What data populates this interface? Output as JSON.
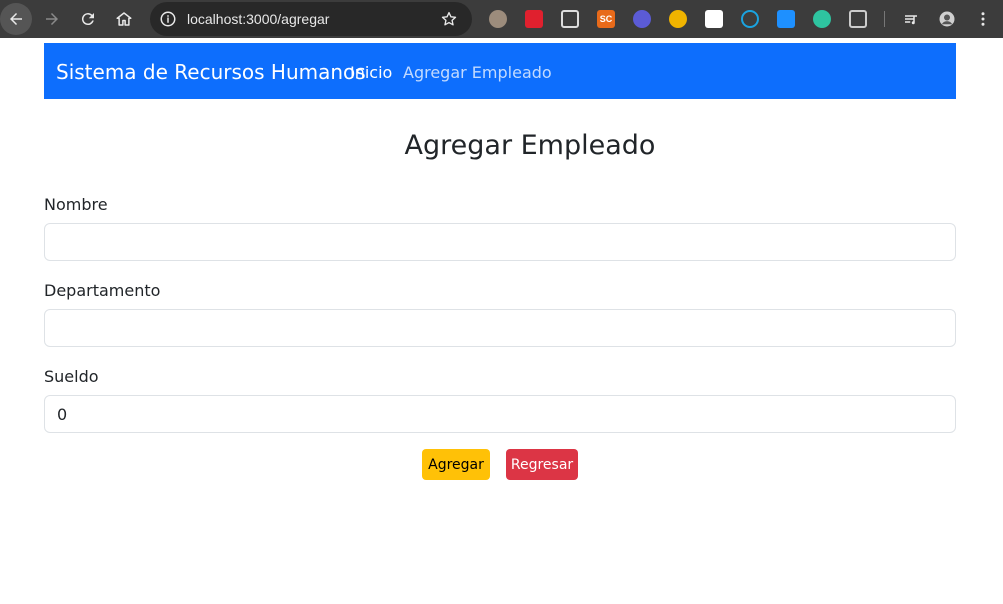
{
  "browser": {
    "url": "localhost:3000/agregar",
    "icons": {
      "back": "arrow-left-icon",
      "forward": "arrow-right-icon",
      "reload": "reload-icon",
      "home": "home-icon",
      "info": "info-icon",
      "bookmark": "star-icon"
    },
    "extensions": [
      {
        "name": "owl-extension-icon",
        "color": "#9c8c7c",
        "text": ""
      },
      {
        "name": "red-m-extension-icon",
        "color": "#e0202e",
        "text": ""
      },
      {
        "name": "window-extension-icon",
        "color": "#dddddd",
        "text": ""
      },
      {
        "name": "sc-extension-icon",
        "color": "#e86a1a",
        "text": "SC"
      },
      {
        "name": "ghost-extension-icon",
        "color": "#5b5bd6",
        "text": ""
      },
      {
        "name": "chrome-color-extension-icon",
        "color": "#f0b400",
        "text": ""
      },
      {
        "name": "pen-extension-icon",
        "color": "#ffffff",
        "text": ""
      },
      {
        "name": "fingerprint-extension-icon",
        "color": "#1aa3e0",
        "text": ""
      },
      {
        "name": "bird-extension-icon",
        "color": "#1e90ff",
        "text": ""
      },
      {
        "name": "teal-extension-icon",
        "color": "#2ec4a0",
        "text": ""
      },
      {
        "name": "puzzle-extension-icon",
        "color": "#cccccc",
        "text": ""
      }
    ]
  },
  "navbar": {
    "brand": "Sistema de Recursos Humanos",
    "links": [
      "Inicio",
      "Agregar Empleado"
    ],
    "color": "#0d6efd"
  },
  "form": {
    "title": "Agregar Empleado",
    "fields": [
      {
        "label": "Nombre",
        "value": ""
      },
      {
        "label": "Departamento",
        "value": ""
      },
      {
        "label": "Sueldo",
        "value": "0"
      }
    ],
    "buttons": {
      "submit": "Agregar",
      "back": "Regresar"
    }
  }
}
